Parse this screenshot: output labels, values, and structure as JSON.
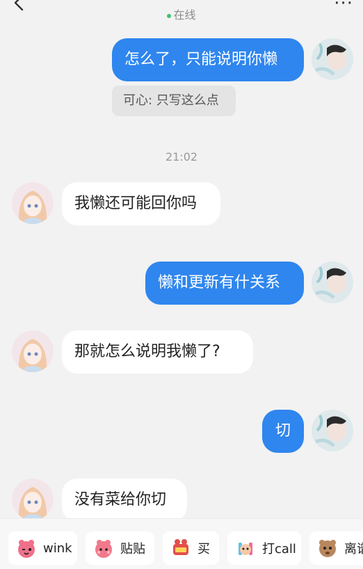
{
  "header": {
    "status": "在线",
    "status_color": "#3cc36b"
  },
  "quote": {
    "text": "可心: 只写这么点"
  },
  "timestamp": "21:02",
  "messages": [
    {
      "from": "me",
      "text": "怎么了，只能说明你懒"
    },
    {
      "from": "other",
      "text": "我懒还可能回你吗"
    },
    {
      "from": "me",
      "text": "懒和更新有什关系"
    },
    {
      "from": "other",
      "text": "那就怎么说明我懒了?"
    },
    {
      "from": "me",
      "text": "切"
    },
    {
      "from": "other",
      "text": "没有菜给你切"
    }
  ],
  "colors": {
    "outgoing_bubble": "#2f86ee",
    "incoming_bubble": "#ffffff",
    "background": "#f2f2f2"
  },
  "quick_actions": [
    {
      "label": "wink",
      "icon": "wink-sticker-icon"
    },
    {
      "label": "贴贴",
      "icon": "hug-sticker-icon"
    },
    {
      "label": "买",
      "icon": "buy-sticker-icon"
    },
    {
      "label": "打call",
      "icon": "cheer-sticker-icon"
    },
    {
      "label": "离谱",
      "icon": "absurd-sticker-icon"
    }
  ]
}
